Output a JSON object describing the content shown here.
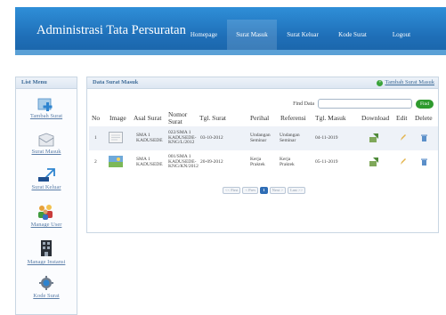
{
  "header": {
    "title": "Administrasi Tata Persuratan",
    "nav": [
      "Homepage",
      "Surat Masuk",
      "Surat Keluar",
      "Kode Surat",
      "Logout"
    ],
    "active_nav": "Surat Masuk"
  },
  "sidebar": {
    "title": "List Menu",
    "items": [
      {
        "label": "Tambah Surat",
        "icon": "add-mail-icon"
      },
      {
        "label": "Surat Masuk",
        "icon": "inbox-mail-icon"
      },
      {
        "label": "Surat Keluar",
        "icon": "outbox-arrow-icon"
      },
      {
        "label": "Manage User",
        "icon": "users-group-icon"
      },
      {
        "label": "Manage Instansi",
        "icon": "building-icon"
      },
      {
        "label": "Kode Surat",
        "icon": "gear-code-icon"
      }
    ]
  },
  "panel": {
    "title": "Data Surat Masuk",
    "add_label": "Tambah Surat Masuk",
    "find_label": "Find Data",
    "find_placeholder": "",
    "find_button": "Find",
    "columns": [
      "No",
      "Image",
      "Asal Surat",
      "Nomor Surat",
      "Tgl. Surat",
      "Perihal",
      "Referensi",
      "Tgl. Masuk",
      "Download",
      "Edit",
      "Delete"
    ],
    "rows": [
      {
        "no": "1",
        "asal": [
          "SMA 1",
          "KADUSEDE"
        ],
        "nomor": [
          "022/SMA 1",
          "KADUSEDE-",
          "KNG/L/2012"
        ],
        "tgl_surat": "03-10-2012",
        "perihal": [
          "Undangan",
          "Seminar"
        ],
        "referensi": [
          "Undangan",
          "Seminar"
        ],
        "tgl_masuk": "04-11-2019"
      },
      {
        "no": "2",
        "asal": [
          "SMA 1",
          "KADUSEDE"
        ],
        "nomor": [
          "001/SMA 1",
          "KADUSEDE-",
          "KNG/KN/2012"
        ],
        "tgl_surat": "20-09-2012",
        "perihal": [
          "Kerja",
          "Praktek"
        ],
        "referensi": [
          "Kerja",
          "Praktek"
        ],
        "tgl_masuk": "05-11-2019"
      }
    ],
    "pager": [
      "<< First",
      "< Prev",
      "1",
      "Next >",
      "Last >>"
    ],
    "pager_active": "1"
  },
  "colors": {
    "header": "#1f6fb8",
    "accent": "#3f6c98",
    "find_button": "#2e9a2e",
    "row_alt": "#eef2f8"
  }
}
